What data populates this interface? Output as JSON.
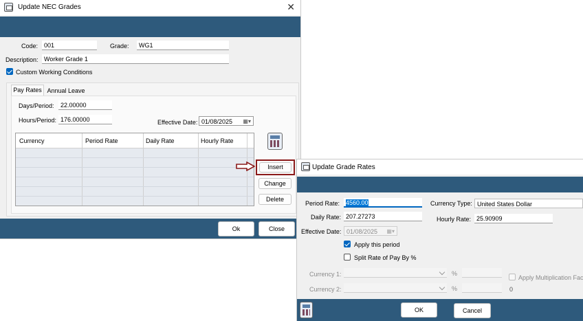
{
  "nec": {
    "title": "Update NEC Grades",
    "code_label": "Code:",
    "code_value": "001",
    "grade_label": "Grade:",
    "grade_value": "WG1",
    "description_label": "Description:",
    "description_value": "Worker Grade 1",
    "custom_label": "Custom Working Conditions",
    "tabs": [
      "Pay Rates",
      "Annual Leave"
    ],
    "days_label": "Days/Period:",
    "days_value": "22.00000",
    "hours_label": "Hours/Period:",
    "hours_value": "176.00000",
    "effective_label": "Effective Date:",
    "effective_value": "01/08/2025",
    "columns": [
      "Currency",
      "Period Rate",
      "Daily Rate",
      "Hourly Rate"
    ],
    "insert": "Insert",
    "change": "Change",
    "delete": "Delete",
    "ok": "Ok",
    "close": "Close"
  },
  "rates": {
    "title": "Update Grade Rates",
    "period_label": "Period Rate:",
    "period_value": "4560.00",
    "currency_type_label": "Currency Type:",
    "currency_type_value": "United States Dollar",
    "daily_label": "Daily Rate:",
    "daily_value": "207.27273",
    "hourly_label": "Hourly Rate:",
    "hourly_value": "25.90909",
    "effective_label": "Effective Date:",
    "effective_value": "01/08/2025",
    "apply_label": "Apply this period",
    "split_label": "Split Rate of Pay By %",
    "currency1_label": "Currency 1:",
    "currency2_label": "Currency 2:",
    "pct1": "%",
    "pct2": "%",
    "apply_mult_label": "Apply Multiplication Facto",
    "mult_value": "0",
    "ok": "OK",
    "cancel": "Cancel"
  },
  "colors": {
    "band": "#2e5a7c",
    "accent": "#0067c0",
    "highlight": "#8b1a1a"
  }
}
